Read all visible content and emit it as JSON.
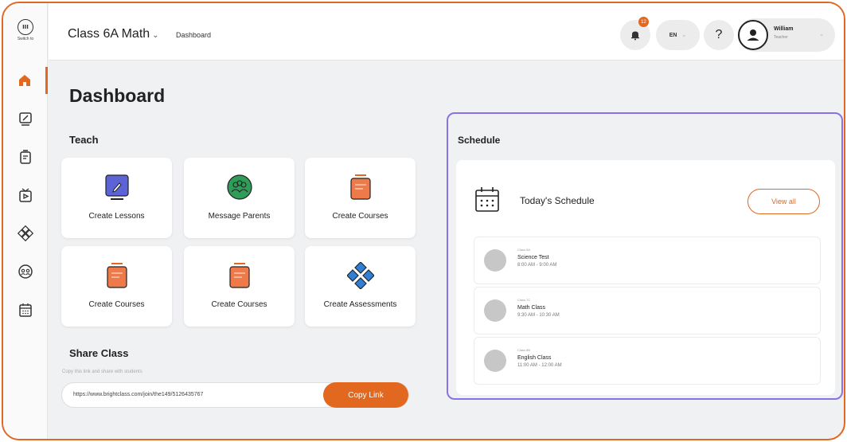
{
  "sidebar": {
    "switch_label": "Switch to",
    "switch_badge": "III",
    "items": [
      {
        "name": "home-icon"
      },
      {
        "name": "edit-icon"
      },
      {
        "name": "document-icon"
      },
      {
        "name": "video-icon"
      },
      {
        "name": "puzzle-icon"
      },
      {
        "name": "group-icon"
      },
      {
        "name": "calendar-icon"
      }
    ]
  },
  "header": {
    "class_title": "Class 6A Math",
    "breadcrumb": "Dashboard",
    "notifications_count": "12",
    "language": "EN",
    "help": "?",
    "user_name": "William",
    "user_role": "Teacher"
  },
  "main": {
    "title": "Dashboard",
    "teach_title": "Teach",
    "cards": [
      {
        "label": "Create Lessons",
        "icon": "lesson-icon"
      },
      {
        "label": "Message Parents",
        "icon": "parents-icon"
      },
      {
        "label": "Create Courses",
        "icon": "course-icon"
      },
      {
        "label": "Create Courses",
        "icon": "course-icon"
      },
      {
        "label": "Create Courses",
        "icon": "course-icon"
      },
      {
        "label": "Create Assessments",
        "icon": "assessment-icon"
      }
    ],
    "share_title": "Share Class",
    "share_subtitle": "Copy this link and share with students",
    "share_link": "https://www.brightclass.com/join/the149/5126435767",
    "copy_label": "Copy Link"
  },
  "schedule": {
    "title": "Schedule",
    "today_title": "Today's Schedule",
    "view_all": "View all",
    "events": [
      {
        "class": "Class 6A",
        "name": "Science Test",
        "time": "8:00 AM - 9:00 AM"
      },
      {
        "class": "Class 7C",
        "name": "Math Class",
        "time": "9:30 AM - 10:30 AM"
      },
      {
        "class": "Class 8B",
        "name": "English Class",
        "time": "11:00 AM - 12:00 AM"
      }
    ]
  },
  "colors": {
    "accent": "#e2671f",
    "highlight": "#8a72e6",
    "lesson": "#5b63d6",
    "parents": "#2f9d57",
    "assessment": "#2f7fd6"
  }
}
